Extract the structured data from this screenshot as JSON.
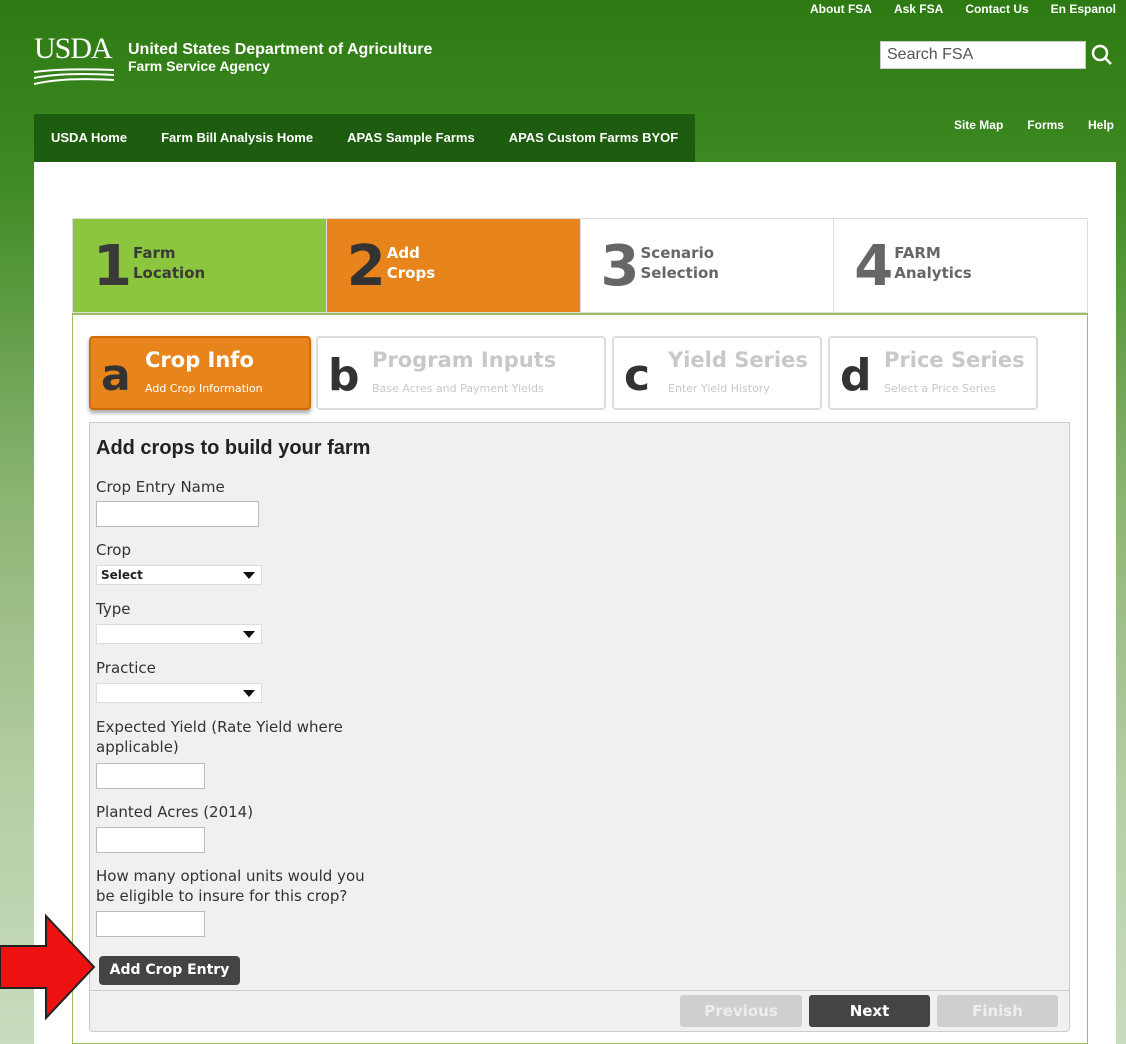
{
  "header": {
    "top_links": [
      "About FSA",
      "Ask FSA",
      "Contact Us",
      "En Espanol"
    ],
    "logo_text": "USDA",
    "agency_line1": "United States Department of Agriculture",
    "agency_line2": "Farm Service Agency",
    "search_placeholder": "Search FSA",
    "search_icon": "search-icon"
  },
  "nav": {
    "items": [
      "USDA Home",
      "Farm Bill Analysis Home",
      "APAS Sample Farms",
      "APAS Custom Farms BYOF"
    ],
    "util_links": [
      "Site Map",
      "Forms",
      "Help"
    ]
  },
  "wizard": {
    "steps": [
      {
        "num": "1",
        "line1": "Farm",
        "line2": "Location",
        "state": "complete"
      },
      {
        "num": "2",
        "line1": "Add",
        "line2": "Crops",
        "state": "active"
      },
      {
        "num": "3",
        "line1": "Scenario",
        "line2": "Selection",
        "state": "pending"
      },
      {
        "num": "4",
        "line1": "FARM",
        "line2": "Analytics",
        "state": "pending"
      }
    ]
  },
  "subtabs": [
    {
      "letter": "a",
      "title": "Crop Info",
      "sub": "Add Crop Information",
      "active": true
    },
    {
      "letter": "b",
      "title": "Program Inputs",
      "sub": "Base Acres and Payment Yields",
      "active": false
    },
    {
      "letter": "c",
      "title": "Yield Series",
      "sub": "Enter Yield History",
      "active": false
    },
    {
      "letter": "d",
      "title": "Price Series",
      "sub": "Select a Price Series",
      "active": false
    }
  ],
  "form": {
    "title": "Add crops to build your farm",
    "crop_entry_name_label": "Crop Entry Name",
    "crop_entry_name_value": "",
    "crop_label": "Crop",
    "crop_selected": "Select",
    "type_label": "Type",
    "type_selected": "",
    "practice_label": "Practice",
    "practice_selected": "",
    "expected_yield_label_1": "Expected Yield (Rate Yield where",
    "expected_yield_label_2": "applicable)",
    "expected_yield_value": "",
    "planted_acres_label": "Planted Acres (2014)",
    "planted_acres_value": "",
    "optional_units_label_1": "How many optional units would you",
    "optional_units_label_2": "be eligible to insure for this crop?",
    "optional_units_value": "",
    "add_button": "Add Crop Entry"
  },
  "footer": {
    "previous": "Previous",
    "next": "Next",
    "finish": "Finish"
  },
  "colors": {
    "brand_green": "#2d7a13",
    "nav_green": "#1e5d0f",
    "step_complete": "#8cc63f",
    "step_active": "#e8841c",
    "arrow_red": "#ee1111"
  }
}
